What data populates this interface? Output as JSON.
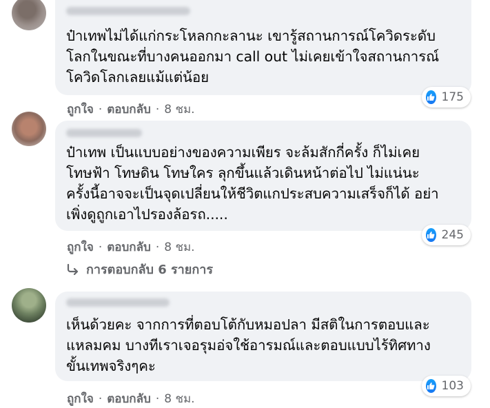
{
  "comments": [
    {
      "text": "ป๋าเทพไม่ได้แก่กระโหลกกะลานะ เขารู้สถานการณ์โควิดระดับ\nโลกในขณะที่บางคนออกมา call out ไม่เคยเข้าใจสถานการณ์\nโควิดโลกเลยแม้แต่น้อย",
      "reactions": "175",
      "like_label": "ถูกใจ",
      "reply_label": "ตอบกลับ",
      "time": "8 ชม."
    },
    {
      "text": "ป๋าเทพ เป็นแบบอย่างของความเพียร จะล้มสักกี่ครั้ง ก็ไม่เคย\nโทษฟ้า โทษดิน โทษใคร ลุกขึ้นแล้วเดินหน้าต่อไป ไม่แน่นะ\nครั้งนี้อาจจะเป็นจุดเปลี่ยนให้ชีวิตแกประสบความเสร็จก็ได้ อย่า\nเพิ่งดูถูกเอาไปรองล้อรถ.....",
      "reactions": "245",
      "like_label": "ถูกใจ",
      "reply_label": "ตอบกลับ",
      "time": "8 ชม."
    },
    {
      "text": "เห็นด้วยคะ จากการที่ตอบโต้กับหมอปลา มีสติในการตอบและ\nแหลมคม บางทีเราเจอรุมอ่จใช้อารมณ์และตอบแบบไร้ทิศทาง\nขั้นเทพจริงๆคะ",
      "reactions": "103",
      "like_label": "ถูกใจ",
      "reply_label": "ตอบกลับ",
      "time": "8 ชม."
    }
  ],
  "replies_link": "การตอบกลับ 6 รายการ",
  "separator": "·",
  "icons": {
    "like": "like-thumb-icon",
    "reply_arrow": "reply-arrow-icon"
  },
  "colors": {
    "bubble": "#f0f2f5",
    "meta": "#65676b",
    "like": "#1877f2"
  }
}
